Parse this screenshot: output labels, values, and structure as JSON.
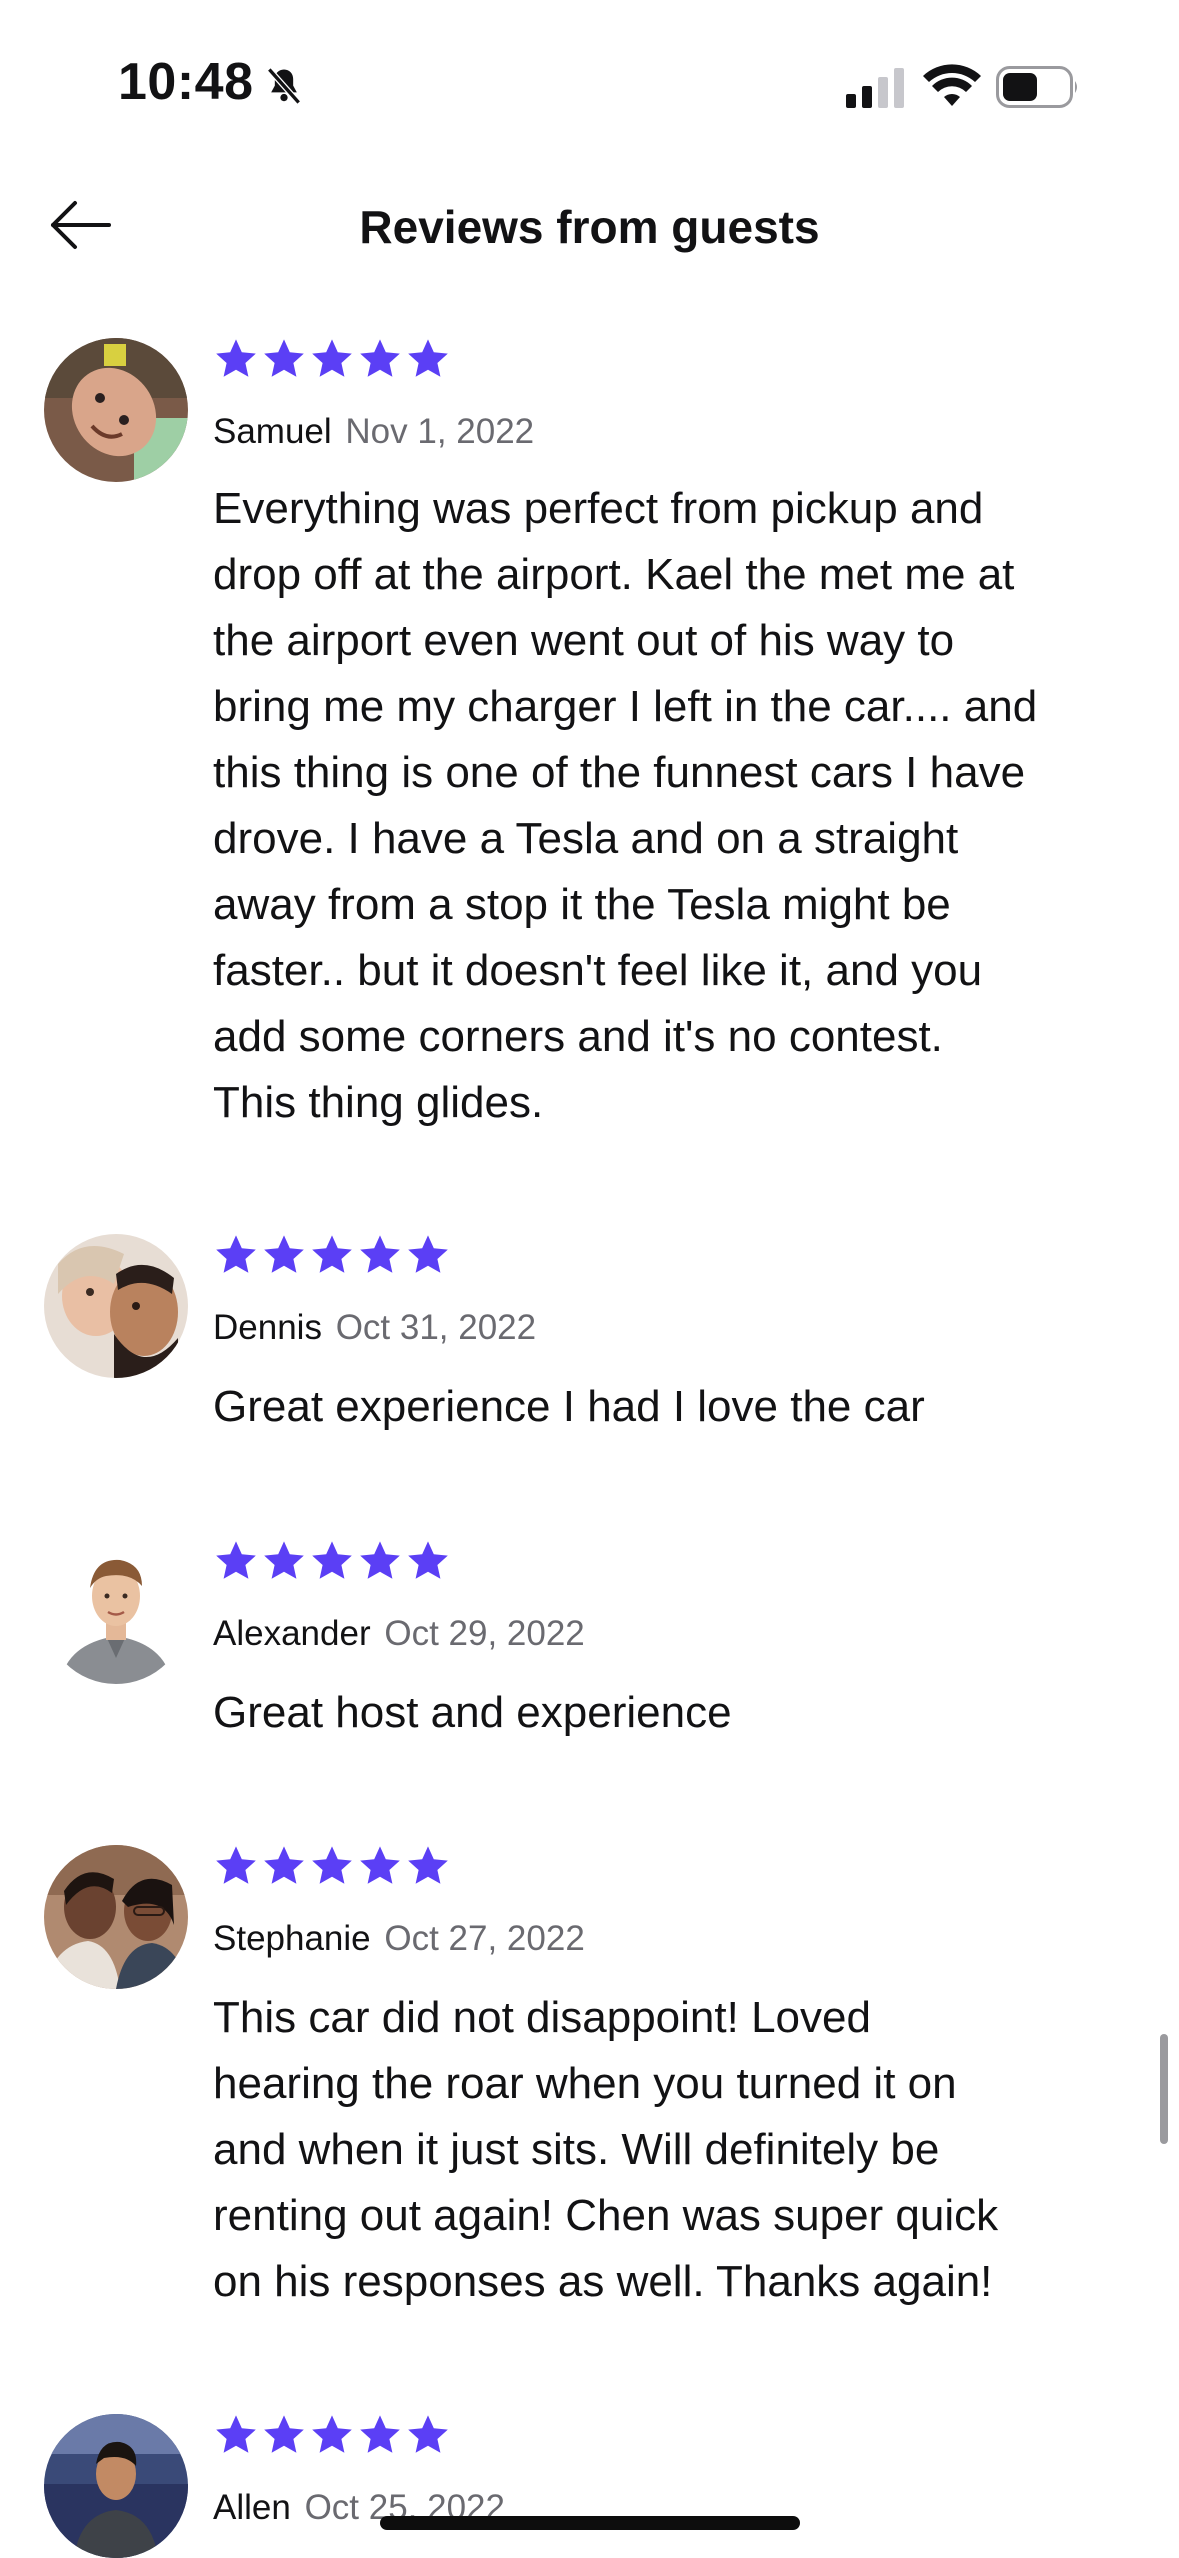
{
  "status_bar": {
    "time": "10:48",
    "bell_icon": "bell-slash-icon",
    "signal_icon": "cellular-signal-icon",
    "wifi_icon": "wifi-icon",
    "battery_icon": "battery-icon"
  },
  "header": {
    "back_icon": "arrow-left-icon",
    "title": "Reviews from guests"
  },
  "colors": {
    "star": "#5b3ff5",
    "text": "#121214",
    "muted": "#6a6a70"
  },
  "reviews": [
    {
      "name": "Samuel",
      "date": "Nov 1, 2022",
      "rating": 5,
      "text": "Everything was perfect from pickup and\ndrop off at the airport. Kael the met me at\nthe airport even went out of his way to\nbring me my charger I left in the car.... and\nthis thing is one of the funnest cars I have\ndrove. I have a Tesla and on a straight\naway from a stop it the Tesla might be\nfaster.. but it doesn't feel like it, and you\nadd some corners and it's no contest.\nThis thing glides."
    },
    {
      "name": "Dennis",
      "date": "Oct 31, 2022",
      "rating": 5,
      "text": "Great experience I had I love the car"
    },
    {
      "name": "Alexander",
      "date": "Oct 29, 2022",
      "rating": 5,
      "text": "Great host and experience"
    },
    {
      "name": "Stephanie",
      "date": "Oct 27, 2022",
      "rating": 5,
      "text": "This car did not disappoint! Loved\nhearing the roar when you turned it on\nand when it just sits. Will definitely be\nrenting out again! Chen was super quick\non his responses as well. Thanks again!"
    },
    {
      "name": "Allen",
      "date": "Oct 25, 2022",
      "rating": 5,
      "text": ""
    }
  ]
}
